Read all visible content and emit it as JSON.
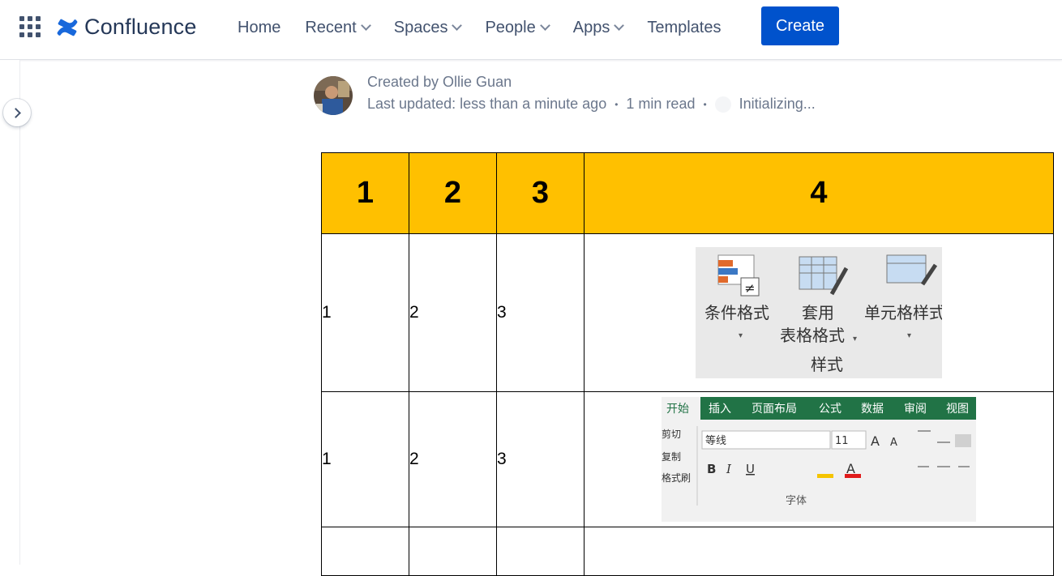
{
  "nav": {
    "product_name": "Confluence",
    "items": [
      {
        "label": "Home",
        "has_dropdown": false
      },
      {
        "label": "Recent",
        "has_dropdown": true
      },
      {
        "label": "Spaces",
        "has_dropdown": true
      },
      {
        "label": "People",
        "has_dropdown": true
      },
      {
        "label": "Apps",
        "has_dropdown": true
      },
      {
        "label": "Templates",
        "has_dropdown": false
      }
    ],
    "create_label": "Create",
    "brand_color": "#0052cc"
  },
  "byline": {
    "created_by": "Created by Ollie Guan",
    "last_updated": "Last updated: less than a minute ago",
    "read_time": "1 min read",
    "status": "Initializing..."
  },
  "table": {
    "header_color": "#ffc000",
    "headers": [
      "1",
      "2",
      "3",
      "4"
    ],
    "rows": [
      {
        "cells": [
          "1",
          "2",
          "3"
        ]
      },
      {
        "cells": [
          "1",
          "2",
          "3"
        ]
      },
      {
        "cells": [
          "",
          "",
          ""
        ]
      }
    ]
  },
  "ribbon_styles": {
    "conditional_format": "条件格式",
    "apply_table_1": "套用",
    "apply_table_2": "表格格式",
    "cell_style": "单元格样式",
    "group": "样式"
  },
  "ribbon_font": {
    "tabs": [
      "开始",
      "插入",
      "页面布局",
      "公式",
      "数据",
      "审阅",
      "视图"
    ],
    "clipboard": [
      "剪切",
      "复制",
      "格式刷"
    ],
    "font_name": "等线",
    "font_size": "11",
    "group": "字体",
    "tab_color": "#217346"
  }
}
